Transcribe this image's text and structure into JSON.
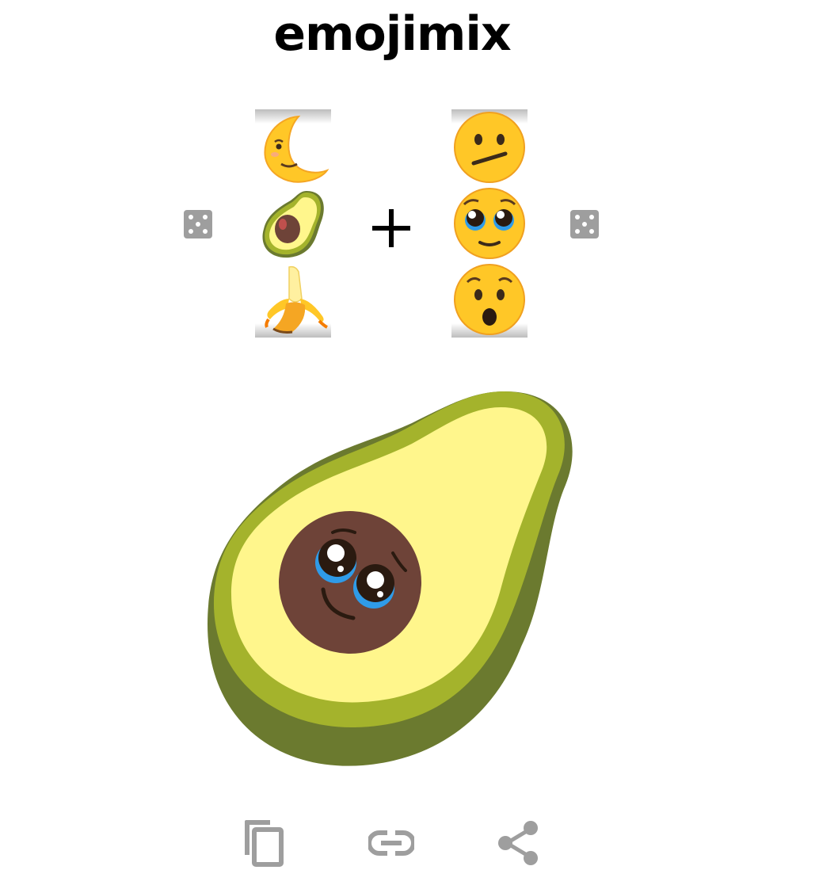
{
  "app": {
    "title": "emojimix"
  },
  "left_reel": {
    "items": [
      "moon-face-emoji",
      "avocado-emoji",
      "banana-emoji"
    ],
    "selected": "avocado-emoji"
  },
  "right_reel": {
    "items": [
      "confused-face-emoji",
      "pleading-face-emoji",
      "hushed-face-emoji"
    ],
    "selected": "pleading-face-emoji"
  },
  "result": {
    "icon": "pleading-avocado-emoji"
  },
  "actions": [
    "copy-icon",
    "link-icon",
    "share-icon"
  ],
  "colors": {
    "icon_gray": "#9e9e9e",
    "avocado_skin": "#6b7a2f",
    "avocado_rim": "#a4b32c",
    "avocado_flesh": "#fff68c",
    "pit": "#6e4338",
    "emoji_yellow": "#ffc727",
    "tear_blue": "#2f9be8"
  }
}
